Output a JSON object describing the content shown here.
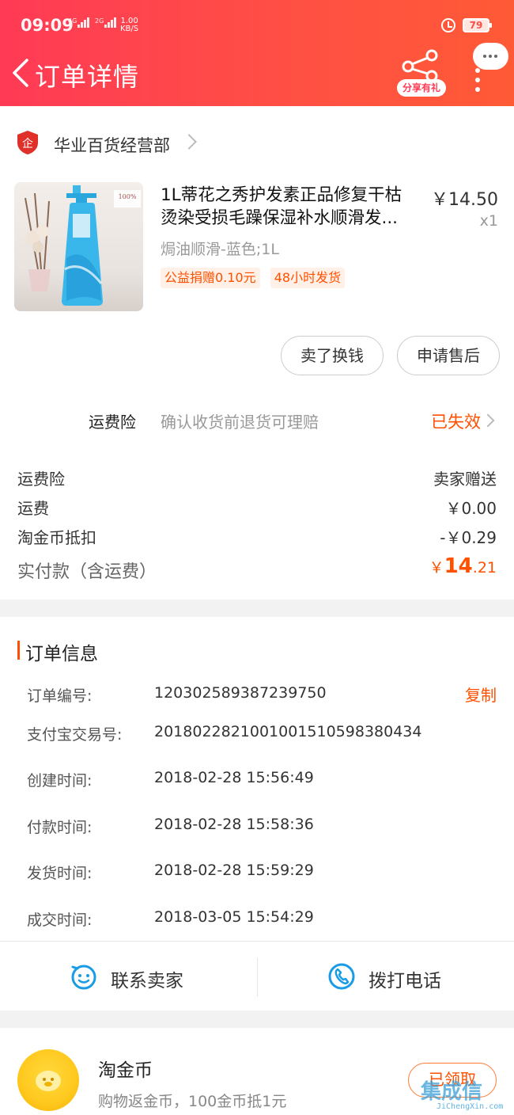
{
  "status_bar": {
    "time": "09:09",
    "net1": "4G",
    "net2": "2G",
    "speed_value": "1.00",
    "speed_unit": "KB/S",
    "battery": "79"
  },
  "header": {
    "title": "订单详情",
    "share_label": "分享有礼",
    "more_dots": "···"
  },
  "shop": {
    "icon_text": "企",
    "name": "华业百货经营部"
  },
  "product": {
    "title": "1L蒂花之秀护发素正品修复干枯烫染受损毛躁保湿补水顺滑发...",
    "price": "￥14.50",
    "quantity": "x1",
    "sku": "焗油顺滑-蓝色;1L",
    "tags": [
      "公益捐赠0.10元",
      "48小时发货"
    ],
    "image_text": "100%"
  },
  "actions": {
    "sell_label": "卖了换钱",
    "after_sale_label": "申请售后"
  },
  "insurance": {
    "label": "运费险",
    "desc": "确认收货前退货可理赔",
    "status": "已失效"
  },
  "fees": [
    {
      "label": "运费险",
      "value": "卖家赠送"
    },
    {
      "label": "运费",
      "value": "￥0.00"
    },
    {
      "label": "淘金币抵扣",
      "value": "-￥0.29"
    }
  ],
  "total": {
    "label": "实付款（含运费）",
    "symbol": "￥",
    "integer": "14",
    "decimal": ".21"
  },
  "order_info": {
    "title": "订单信息",
    "copy_label": "复制",
    "rows": [
      {
        "key": "订单编号:",
        "value": "120302589387239750"
      },
      {
        "key": "支付宝交易号:",
        "value": "2018022821001001510598380434"
      },
      {
        "key": "创建时间:",
        "value": "2018-02-28 15:56:49"
      },
      {
        "key": "付款时间:",
        "value": "2018-02-28 15:58:36"
      },
      {
        "key": "发货时间:",
        "value": "2018-02-28 15:59:29"
      },
      {
        "key": "成交时间:",
        "value": "2018-03-05 15:54:29"
      }
    ]
  },
  "contact": {
    "seller_label": "联系卖家",
    "phone_label": "拨打电话"
  },
  "coins": {
    "title": "淘金币",
    "desc": "购物返金币，100金币抵1元",
    "button_label": "已领取"
  },
  "watermark": {
    "logo": "集成信",
    "url": "JiChengXin.com"
  },
  "colors": {
    "header_start": "#ff3a55",
    "header_end": "#ff5a36",
    "accent_orange": "#ff5000",
    "contact_blue": "#1a9be6"
  }
}
